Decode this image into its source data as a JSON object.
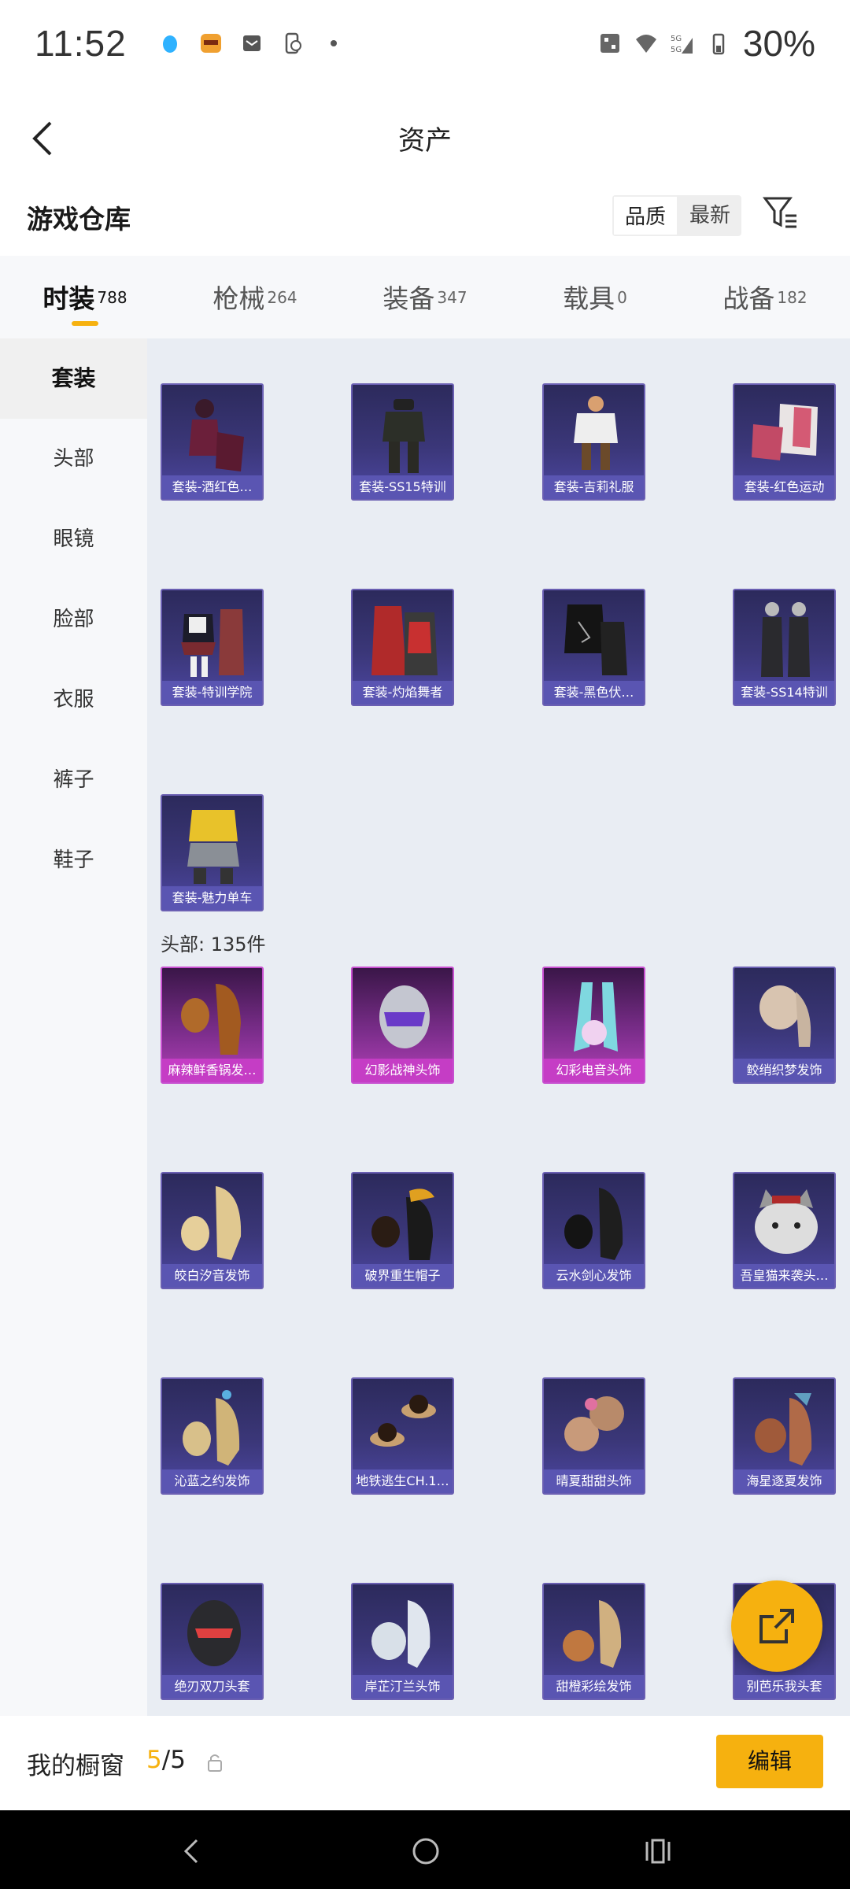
{
  "status": {
    "time": "11:52",
    "battery": "30%"
  },
  "header": {
    "title": "资产"
  },
  "warehouse": {
    "title": "游戏仓库",
    "sort_options": [
      "品质",
      "最新"
    ]
  },
  "tabs": [
    {
      "label": "时装",
      "count": "788"
    },
    {
      "label": "枪械",
      "count": "264"
    },
    {
      "label": "装备",
      "count": "347"
    },
    {
      "label": "载具",
      "count": "0"
    },
    {
      "label": "战备",
      "count": "182"
    }
  ],
  "sidebar": {
    "items": [
      "套装",
      "头部",
      "眼镜",
      "脸部",
      "衣服",
      "裤子",
      "鞋子"
    ]
  },
  "sets": {
    "items": [
      "套装-酒红色…",
      "套装-SS15特训",
      "套装-吉莉礼服",
      "套装-红色运动",
      "套装-特训学院",
      "套装-灼焰舞者",
      "套装-黑色伏…",
      "套装-SS14特训",
      "套装-魅力单车"
    ]
  },
  "head": {
    "section_label": "头部: 135件",
    "items": [
      "麻辣鲜香锅发…",
      "幻影战神头饰",
      "幻彩电音头饰",
      "鲛绡织梦发饰",
      "皎白汐音发饰",
      "破界重生帽子",
      "云水剑心发饰",
      "吾皇猫来袭头…",
      "沁蓝之约发饰",
      "地铁逃生CH.1…",
      "晴夏甜甜头饰",
      "海星逐夏发饰",
      "绝刃双刀头套",
      "岸芷汀兰头饰",
      "甜橙彩绘发饰",
      "别芭乐我头套"
    ]
  },
  "showcase": {
    "label": "我的橱窗",
    "current": "5",
    "separator": "/",
    "total": "5",
    "edit_label": "编辑"
  },
  "colors": {
    "accent": "#f6b10f",
    "card_purple": "#5a55b2",
    "card_pink": "#c53dc5"
  }
}
